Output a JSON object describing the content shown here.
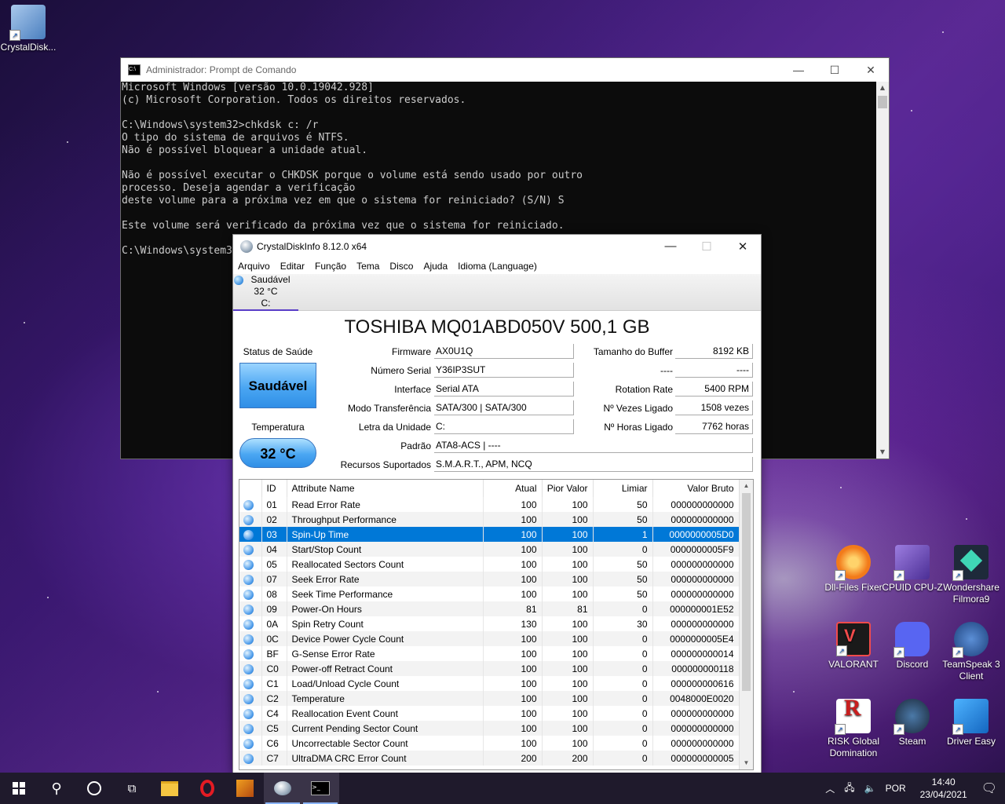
{
  "desktop_icons": [
    {
      "label": "CrystalDisk...",
      "icon": "crystaldiskinfo-icon",
      "color": "#6aa0d8"
    },
    {
      "label": "Dll-Files Fixer",
      "icon": "dll-files-fixer-icon",
      "color": "#f27a1a"
    },
    {
      "label": "CPUID CPU-Z",
      "icon": "cpu-z-icon",
      "color": "#6d4bb3"
    },
    {
      "label": "Wondershare Filmora9",
      "icon": "filmora-icon",
      "color": "#1e2a3a"
    },
    {
      "label": "VALORANT",
      "icon": "valorant-icon",
      "color": "#f24b4b"
    },
    {
      "label": "Discord",
      "icon": "discord-icon",
      "color": "#5865f2"
    },
    {
      "label": "TeamSpeak 3 Client",
      "icon": "teamspeak-icon",
      "color": "#2b5ea8"
    },
    {
      "label": "RISK Global Domination",
      "icon": "risk-icon",
      "color": "#c81e1e"
    },
    {
      "label": "Steam",
      "icon": "steam-icon",
      "color": "#1b2838"
    },
    {
      "label": "Driver Easy",
      "icon": "driver-easy-icon",
      "color": "#2a8fe0"
    }
  ],
  "cmd": {
    "title": "Administrador: Prompt de Comando",
    "lines": [
      "Microsoft Windows [versão 10.0.19042.928]",
      "(c) Microsoft Corporation. Todos os direitos reservados.",
      "",
      "C:\\Windows\\system32>chkdsk c: /r",
      "O tipo do sistema de arquivos é NTFS.",
      "Não é possível bloquear a unidade atual.",
      "",
      "Não é possível executar o CHKDSK porque o volume está sendo usado por outro",
      "processo. Deseja agendar a verificação",
      "deste volume para a próxima vez em que o sistema for reiniciado? (S/N) S",
      "",
      "Este volume será verificado da próxima vez que o sistema for reiniciado.",
      "",
      "C:\\Windows\\system32>"
    ]
  },
  "cdi": {
    "title": "CrystalDiskInfo 8.12.0 x64",
    "menu": [
      "Arquivo",
      "Editar",
      "Função",
      "Tema",
      "Disco",
      "Ajuda",
      "Idioma (Language)"
    ],
    "disk_tab": {
      "status": "Saudável",
      "temp": "32 °C",
      "drive": "C:"
    },
    "model": "TOSHIBA MQ01ABD050V 500,1 GB",
    "health_label": "Status de Saúde",
    "health_value": "Saudável",
    "temp_label": "Temperatura",
    "temp_value": "32 °C",
    "left_fields": [
      {
        "label": "Firmware",
        "value": "AX0U1Q"
      },
      {
        "label": "Número Serial",
        "value": "Y36IP3SUT"
      },
      {
        "label": "Interface",
        "value": "Serial ATA"
      },
      {
        "label": "Modo Transferência",
        "value": "SATA/300 | SATA/300"
      },
      {
        "label": "Letra da Unidade",
        "value": "C:"
      }
    ],
    "right_fields": [
      {
        "label": "Tamanho do Buffer",
        "value": "8192 KB"
      },
      {
        "label": "----",
        "value": "----"
      },
      {
        "label": "Rotation Rate",
        "value": "5400 RPM"
      },
      {
        "label": "Nº Vezes Ligado",
        "value": "1508 vezes"
      },
      {
        "label": "Nº Horas Ligado",
        "value": "7762 horas"
      }
    ],
    "standard": {
      "label": "Padrão",
      "value": "ATA8-ACS | ----"
    },
    "features": {
      "label": "Recursos Suportados",
      "value": "S.M.A.R.T., APM, NCQ"
    },
    "columns": [
      "ID",
      "Attribute Name",
      "Atual",
      "Pior Valor",
      "Limiar",
      "Valor Bruto"
    ],
    "rows": [
      [
        "01",
        "Read Error Rate",
        "100",
        "100",
        "50",
        "000000000000"
      ],
      [
        "02",
        "Throughput Performance",
        "100",
        "100",
        "50",
        "000000000000"
      ],
      [
        "03",
        "Spin-Up Time",
        "100",
        "100",
        "1",
        "0000000005D0"
      ],
      [
        "04",
        "Start/Stop Count",
        "100",
        "100",
        "0",
        "0000000005F9"
      ],
      [
        "05",
        "Reallocated Sectors Count",
        "100",
        "100",
        "50",
        "000000000000"
      ],
      [
        "07",
        "Seek Error Rate",
        "100",
        "100",
        "50",
        "000000000000"
      ],
      [
        "08",
        "Seek Time Performance",
        "100",
        "100",
        "50",
        "000000000000"
      ],
      [
        "09",
        "Power-On Hours",
        "81",
        "81",
        "0",
        "000000001E52"
      ],
      [
        "0A",
        "Spin Retry Count",
        "130",
        "100",
        "30",
        "000000000000"
      ],
      [
        "0C",
        "Device Power Cycle Count",
        "100",
        "100",
        "0",
        "0000000005E4"
      ],
      [
        "BF",
        "G-Sense Error Rate",
        "100",
        "100",
        "0",
        "000000000014"
      ],
      [
        "C0",
        "Power-off Retract Count",
        "100",
        "100",
        "0",
        "000000000118"
      ],
      [
        "C1",
        "Load/Unload Cycle Count",
        "100",
        "100",
        "0",
        "000000000616"
      ],
      [
        "C2",
        "Temperature",
        "100",
        "100",
        "0",
        "0048000E0020"
      ],
      [
        "C4",
        "Reallocation Event Count",
        "100",
        "100",
        "0",
        "000000000000"
      ],
      [
        "C5",
        "Current Pending Sector Count",
        "100",
        "100",
        "0",
        "000000000000"
      ],
      [
        "C6",
        "Uncorrectable Sector Count",
        "100",
        "100",
        "0",
        "000000000000"
      ],
      [
        "C7",
        "UltraDMA CRC Error Count",
        "200",
        "200",
        "0",
        "000000000005"
      ]
    ],
    "selected_row": 2
  },
  "taskbar": {
    "items": [
      "start",
      "search",
      "task-view",
      "widgets",
      "file-explorer",
      "opera",
      "app-game",
      "crystaldiskinfo",
      "cmd"
    ],
    "language": "POR",
    "time": "14:40",
    "date": "23/04/2021"
  },
  "colors": {
    "accent": "#0078d7",
    "selection": "#0078d7",
    "health": "#4aa6f2"
  }
}
